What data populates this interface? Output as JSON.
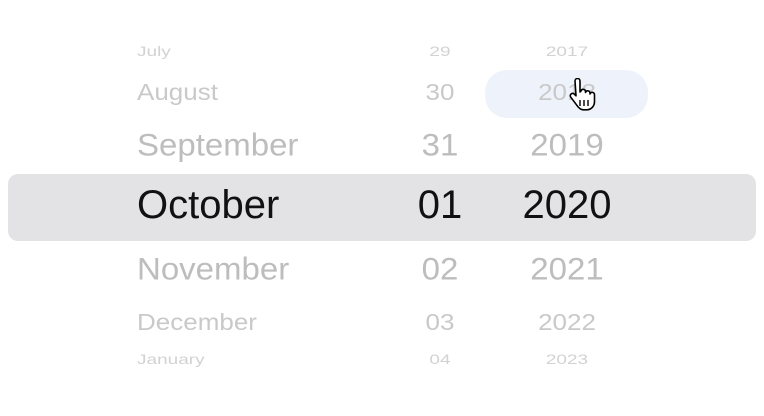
{
  "picker": {
    "rows": [
      {
        "month": "July",
        "day": "29",
        "year": "2017"
      },
      {
        "month": "August",
        "day": "30",
        "year": "2018"
      },
      {
        "month": "September",
        "day": "31",
        "year": "2019"
      },
      {
        "month": "October",
        "day": "01",
        "year": "2020"
      },
      {
        "month": "November",
        "day": "02",
        "year": "2021"
      },
      {
        "month": "December",
        "day": "03",
        "year": "2022"
      },
      {
        "month": "January",
        "day": "04",
        "year": "2023"
      }
    ],
    "selected_index": 3,
    "hovered": "year-2018"
  },
  "colors": {
    "selection": "#e3e3e5",
    "hover": "#eef3fb",
    "selected_text": "#111111",
    "faded_text": "#c4c4c4"
  }
}
